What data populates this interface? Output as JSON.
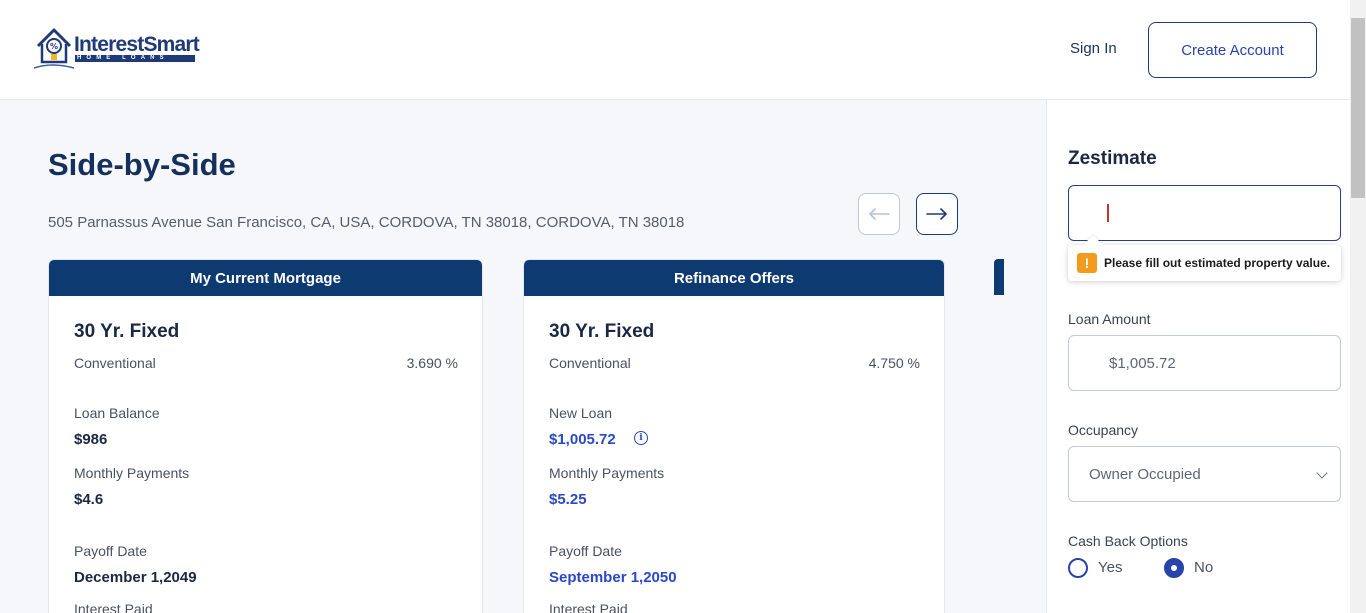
{
  "header": {
    "logo_text": "InterestSmart",
    "logo_sub": "HOME LOANS",
    "sign_in": "Sign In",
    "create_account": "Create Account"
  },
  "main": {
    "title": "Side-by-Side",
    "address": "505 Parnassus Avenue San Francisco, CA, USA, CORDOVA, TN 38018, CORDOVA, TN 38018",
    "nav": {
      "prev": "←",
      "next": "→"
    },
    "cards": [
      {
        "header": "My Current Mortgage",
        "title": "30 Yr. Fixed",
        "loan_type": "Conventional",
        "rate": "3.690 %",
        "balance_label": "Loan Balance",
        "balance_value": "$986",
        "monthly_label": "Monthly Payments",
        "monthly_value": "$4.6",
        "payoff_label": "Payoff Date",
        "payoff_value": "December 1,2049",
        "interest_label": "Interest Paid"
      },
      {
        "header": "Refinance Offers",
        "title": "30 Yr. Fixed",
        "loan_type": "Conventional",
        "rate": "4.750 %",
        "balance_label": "New Loan",
        "balance_value": "$1,005.72",
        "info_icon": "info-icon",
        "monthly_label": "Monthly Payments",
        "monthly_value": "$5.25",
        "payoff_label": "Payoff Date",
        "payoff_value": "September 1,2050",
        "interest_label": "Interest Paid"
      }
    ]
  },
  "sidebar": {
    "title": "Zestimate",
    "zestimate_value": "",
    "tooltip": "Please fill out estimated property value.",
    "loan_amount_label": "Loan Amount",
    "loan_amount_value": "$1,005.72",
    "occupancy_label": "Occupancy",
    "occupancy_value": "Owner Occupied",
    "cash_back_label": "Cash Back Options",
    "cash_back_options": [
      "Yes",
      "No"
    ],
    "cash_back_selected": "No"
  },
  "colors": {
    "brand_navy": "#0e3a72",
    "accent_blue": "#2b48c9",
    "warning": "#f29b1d"
  }
}
